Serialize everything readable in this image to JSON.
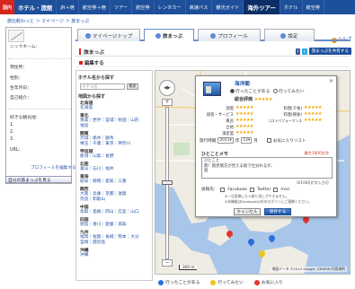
{
  "nav": {
    "logo": "国内",
    "items": [
      "ホテル・旅館",
      "JR＋宿",
      "航空券＋宿",
      "ツアー",
      "航空券",
      "レンタカー",
      "高速バス",
      "観光ガイド",
      "海外ツアー",
      "ホテル",
      "航空券"
    ]
  },
  "breadcrumb": "旅比較わっと ＞ マイページ ＞ 旅まっぷ",
  "help": "ヘルプ",
  "profile": {
    "nickname_label": "ニックネーム：",
    "residence_label": "現住所：",
    "gender_label": "性別：",
    "birth_label": "生年月日：",
    "intro_label": "自己紹介：",
    "favorites_label": "好きな観光地：",
    "favorites": [
      "1.",
      "2.",
      "3."
    ],
    "url_label": "URL：",
    "edit_link": "プロフィールを編集する",
    "view_button": "自分の旅まっぷを見る"
  },
  "tabs": [
    {
      "label": "マイページトップ",
      "active": false
    },
    {
      "label": "旅まっぷ",
      "active": true
    },
    {
      "label": "プロフィール",
      "active": false
    },
    {
      "label": "設定",
      "active": false
    }
  ],
  "section_title": "旅まっぷ",
  "social": {
    "fb": "f",
    "tw": "t",
    "share": "旅まっぷを共有する"
  },
  "section_sub": "編集する",
  "search": {
    "hotel_head": "ホテル名から探す",
    "input_placeholder": "ホテル名",
    "button": "検索",
    "area_head": "地図から探す",
    "regions": [
      {
        "name": "北海道",
        "prefs": [
          "北海道"
        ]
      },
      {
        "name": "東北",
        "prefs": [
          "青森｜岩手｜宮城｜秋田｜山形",
          "福島"
        ]
      },
      {
        "name": "関東",
        "prefs": [
          "茨城｜栃木｜群馬",
          "埼玉｜千葉｜東京｜神奈川"
        ]
      },
      {
        "name": "甲信越",
        "prefs": [
          "新潟｜山梨｜長野"
        ]
      },
      {
        "name": "北陸",
        "prefs": [
          "富山｜石川｜福井"
        ]
      },
      {
        "name": "東海",
        "prefs": [
          "岐阜｜静岡｜愛知｜三重"
        ]
      },
      {
        "name": "関西",
        "prefs": [
          "大阪｜兵庫｜京都｜滋賀",
          "奈良｜和歌山"
        ]
      },
      {
        "name": "中国",
        "prefs": [
          "鳥取｜島根｜岡山｜広島｜山口"
        ]
      },
      {
        "name": "四国",
        "prefs": [
          "徳島｜香川｜愛媛｜高知"
        ]
      },
      {
        "name": "九州",
        "prefs": [
          "福岡｜佐賀｜長崎｜熊本｜大分",
          "宮崎｜鹿児島"
        ]
      },
      {
        "name": "沖縄",
        "prefs": [
          "沖縄"
        ]
      }
    ]
  },
  "map": {
    "pan": "◀▶",
    "scale": "300 m",
    "credit": "地図データ ©2012 Google, ZENRIN 利用規約"
  },
  "popup": {
    "close": "×",
    "title": "海洋閣",
    "radio_went": "行ったことがある",
    "radio_want": "行ってみたい",
    "overall_label": "総合評価",
    "overall_stars": "★★★★★",
    "ratings": [
      {
        "label": "部屋",
        "stars": "★★★★★"
      },
      {
        "label": "接客・サービス",
        "stars": "★★★★★"
      },
      {
        "label": "風呂",
        "stars": "★★★★★"
      },
      {
        "label": "立地",
        "stars": "★★★★★"
      },
      {
        "label": "満足度",
        "stars": "★★★★★"
      },
      {
        "label": "料理(夕食)",
        "stars": "★★★★★"
      },
      {
        "label": "料理(朝食)",
        "stars": "★★★★★"
      },
      {
        "label": "コストパフォーマンス",
        "stars": "★★★★★"
      }
    ],
    "date_label": "旅行時期",
    "year": "2011",
    "year_unit": "年",
    "month": "12",
    "month_unit": "月",
    "checkbox_label": "お気に入りリスト",
    "memo_label": "ひとことメモ",
    "memo_note": "最大1000文字",
    "memo_text": "ひとこと\n無！無見無方が見える宿で仕分れるが、\n宿",
    "memo_count": "0/1000文字入力可",
    "post_label": "投稿先：",
    "post_facebook": "Facebook",
    "post_twitter": "Twitter",
    "post_mixi": "mixi",
    "post_note_1": "※一旦投稿したら取り消しができません。",
    "post_note_2": "※本機能はFacebook以外のログインにご連携ください。",
    "cancel": "キャンセル",
    "save": "保存する"
  },
  "legend": {
    "went": "行ったことがある",
    "want": "行ってみたい",
    "favorite": "お気に入り"
  },
  "colors": {
    "nav_bg": "#1d4f9a",
    "accent_red": "#d7261e",
    "map_water": "#a8c6ea",
    "star": "#f5a300"
  }
}
